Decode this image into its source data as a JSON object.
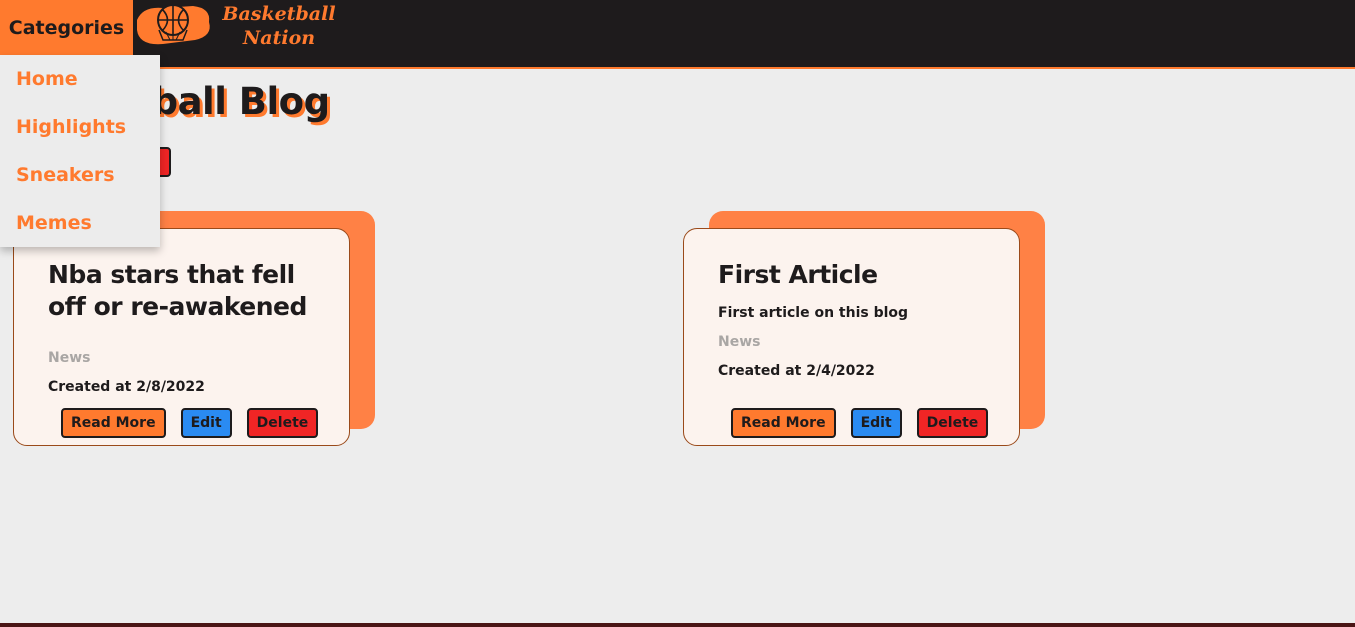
{
  "header": {
    "categories_label": "Categories",
    "logo_line1": "Basketball",
    "logo_line2": "Nation"
  },
  "menu": {
    "items": [
      {
        "label": "Home"
      },
      {
        "label": "Highlights"
      },
      {
        "label": "Sneakers"
      },
      {
        "label": "Memes"
      }
    ]
  },
  "main": {
    "title": "Basketball Blog"
  },
  "articles": [
    {
      "title": "Nba stars that fell off or re-awakened",
      "description": "",
      "category": "News",
      "created": "Created at 2/8/2022",
      "read_label": "Read More",
      "edit_label": "Edit",
      "delete_label": "Delete"
    },
    {
      "title": "First Article",
      "description": "First article on this blog",
      "category": "News",
      "created": "Created at 2/4/2022",
      "read_label": "Read More",
      "edit_label": "Edit",
      "delete_label": "Delete"
    }
  ],
  "colors": {
    "accent": "#ff7a2e",
    "header_bg": "#1e1b1c",
    "edit": "#2a8bf2",
    "delete": "#f02525"
  }
}
